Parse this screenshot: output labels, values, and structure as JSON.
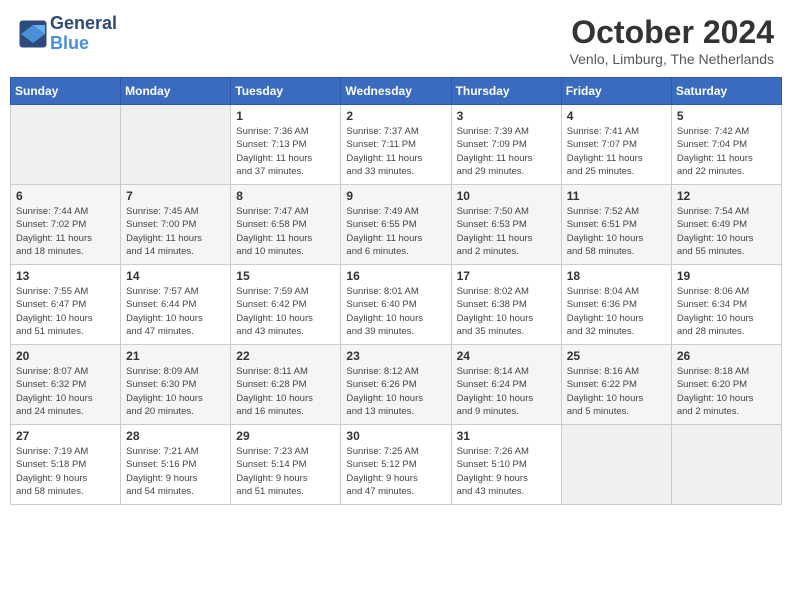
{
  "header": {
    "logo_line1": "General",
    "logo_line2": "Blue",
    "month_year": "October 2024",
    "location": "Venlo, Limburg, The Netherlands"
  },
  "days_of_week": [
    "Sunday",
    "Monday",
    "Tuesday",
    "Wednesday",
    "Thursday",
    "Friday",
    "Saturday"
  ],
  "weeks": [
    [
      {
        "day": "",
        "info": ""
      },
      {
        "day": "",
        "info": ""
      },
      {
        "day": "1",
        "info": "Sunrise: 7:36 AM\nSunset: 7:13 PM\nDaylight: 11 hours\nand 37 minutes."
      },
      {
        "day": "2",
        "info": "Sunrise: 7:37 AM\nSunset: 7:11 PM\nDaylight: 11 hours\nand 33 minutes."
      },
      {
        "day": "3",
        "info": "Sunrise: 7:39 AM\nSunset: 7:09 PM\nDaylight: 11 hours\nand 29 minutes."
      },
      {
        "day": "4",
        "info": "Sunrise: 7:41 AM\nSunset: 7:07 PM\nDaylight: 11 hours\nand 25 minutes."
      },
      {
        "day": "5",
        "info": "Sunrise: 7:42 AM\nSunset: 7:04 PM\nDaylight: 11 hours\nand 22 minutes."
      }
    ],
    [
      {
        "day": "6",
        "info": "Sunrise: 7:44 AM\nSunset: 7:02 PM\nDaylight: 11 hours\nand 18 minutes."
      },
      {
        "day": "7",
        "info": "Sunrise: 7:45 AM\nSunset: 7:00 PM\nDaylight: 11 hours\nand 14 minutes."
      },
      {
        "day": "8",
        "info": "Sunrise: 7:47 AM\nSunset: 6:58 PM\nDaylight: 11 hours\nand 10 minutes."
      },
      {
        "day": "9",
        "info": "Sunrise: 7:49 AM\nSunset: 6:55 PM\nDaylight: 11 hours\nand 6 minutes."
      },
      {
        "day": "10",
        "info": "Sunrise: 7:50 AM\nSunset: 6:53 PM\nDaylight: 11 hours\nand 2 minutes."
      },
      {
        "day": "11",
        "info": "Sunrise: 7:52 AM\nSunset: 6:51 PM\nDaylight: 10 hours\nand 58 minutes."
      },
      {
        "day": "12",
        "info": "Sunrise: 7:54 AM\nSunset: 6:49 PM\nDaylight: 10 hours\nand 55 minutes."
      }
    ],
    [
      {
        "day": "13",
        "info": "Sunrise: 7:55 AM\nSunset: 6:47 PM\nDaylight: 10 hours\nand 51 minutes."
      },
      {
        "day": "14",
        "info": "Sunrise: 7:57 AM\nSunset: 6:44 PM\nDaylight: 10 hours\nand 47 minutes."
      },
      {
        "day": "15",
        "info": "Sunrise: 7:59 AM\nSunset: 6:42 PM\nDaylight: 10 hours\nand 43 minutes."
      },
      {
        "day": "16",
        "info": "Sunrise: 8:01 AM\nSunset: 6:40 PM\nDaylight: 10 hours\nand 39 minutes."
      },
      {
        "day": "17",
        "info": "Sunrise: 8:02 AM\nSunset: 6:38 PM\nDaylight: 10 hours\nand 35 minutes."
      },
      {
        "day": "18",
        "info": "Sunrise: 8:04 AM\nSunset: 6:36 PM\nDaylight: 10 hours\nand 32 minutes."
      },
      {
        "day": "19",
        "info": "Sunrise: 8:06 AM\nSunset: 6:34 PM\nDaylight: 10 hours\nand 28 minutes."
      }
    ],
    [
      {
        "day": "20",
        "info": "Sunrise: 8:07 AM\nSunset: 6:32 PM\nDaylight: 10 hours\nand 24 minutes."
      },
      {
        "day": "21",
        "info": "Sunrise: 8:09 AM\nSunset: 6:30 PM\nDaylight: 10 hours\nand 20 minutes."
      },
      {
        "day": "22",
        "info": "Sunrise: 8:11 AM\nSunset: 6:28 PM\nDaylight: 10 hours\nand 16 minutes."
      },
      {
        "day": "23",
        "info": "Sunrise: 8:12 AM\nSunset: 6:26 PM\nDaylight: 10 hours\nand 13 minutes."
      },
      {
        "day": "24",
        "info": "Sunrise: 8:14 AM\nSunset: 6:24 PM\nDaylight: 10 hours\nand 9 minutes."
      },
      {
        "day": "25",
        "info": "Sunrise: 8:16 AM\nSunset: 6:22 PM\nDaylight: 10 hours\nand 5 minutes."
      },
      {
        "day": "26",
        "info": "Sunrise: 8:18 AM\nSunset: 6:20 PM\nDaylight: 10 hours\nand 2 minutes."
      }
    ],
    [
      {
        "day": "27",
        "info": "Sunrise: 7:19 AM\nSunset: 5:18 PM\nDaylight: 9 hours\nand 58 minutes."
      },
      {
        "day": "28",
        "info": "Sunrise: 7:21 AM\nSunset: 5:16 PM\nDaylight: 9 hours\nand 54 minutes."
      },
      {
        "day": "29",
        "info": "Sunrise: 7:23 AM\nSunset: 5:14 PM\nDaylight: 9 hours\nand 51 minutes."
      },
      {
        "day": "30",
        "info": "Sunrise: 7:25 AM\nSunset: 5:12 PM\nDaylight: 9 hours\nand 47 minutes."
      },
      {
        "day": "31",
        "info": "Sunrise: 7:26 AM\nSunset: 5:10 PM\nDaylight: 9 hours\nand 43 minutes."
      },
      {
        "day": "",
        "info": ""
      },
      {
        "day": "",
        "info": ""
      }
    ]
  ]
}
